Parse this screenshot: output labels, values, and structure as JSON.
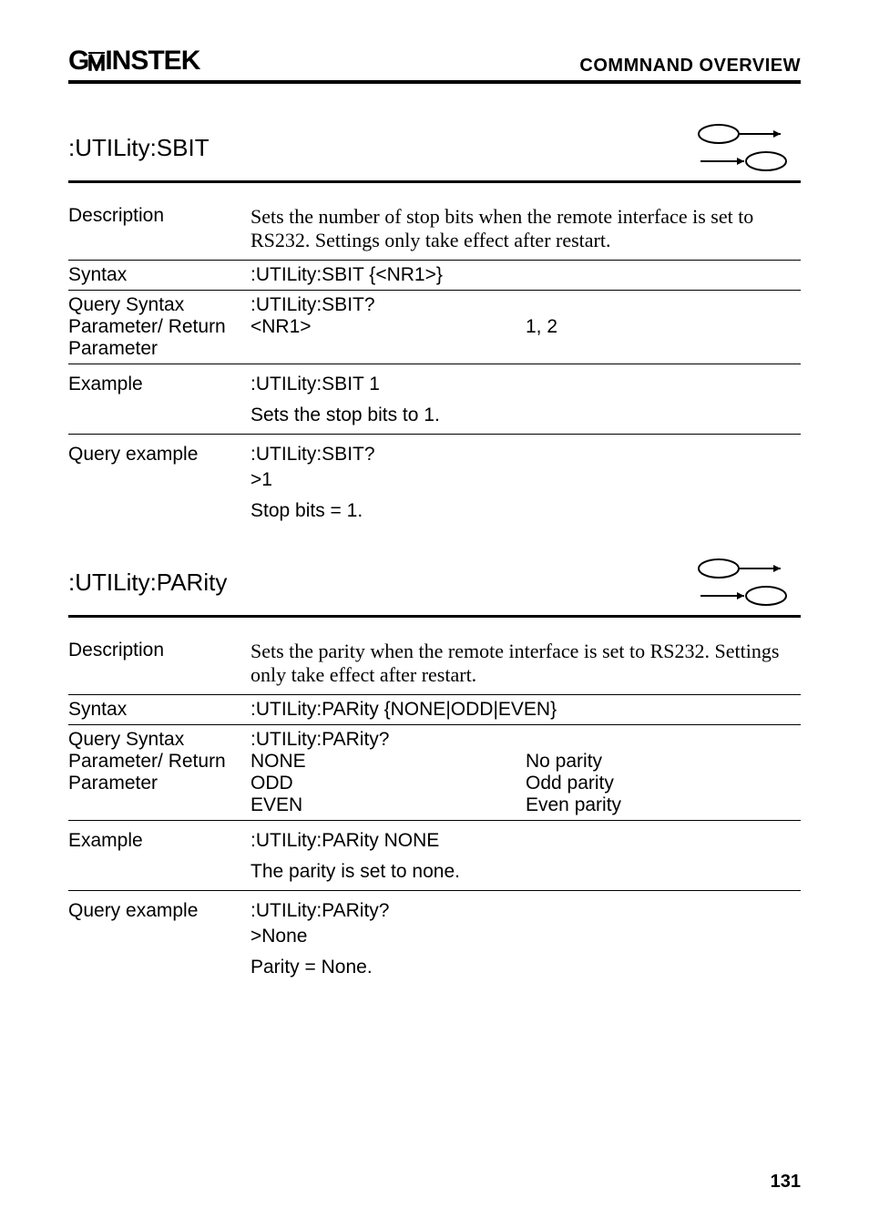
{
  "header": {
    "logo_text": "GWINSTEK",
    "page_header": "COMMNAND OVERVIEW"
  },
  "section1": {
    "title": ":UTILity:SBIT",
    "description_label": "Description",
    "description_text": "Sets the number of stop bits when the remote interface is set to RS232. Settings only take effect after restart.",
    "syntax_label": "Syntax",
    "syntax_value": ":UTILity:SBIT {<NR1>}",
    "query_syntax_label": "Query Syntax",
    "query_syntax_value": ":UTILity:SBIT?",
    "param_label": "Parameter/ Return Parameter",
    "param_key": "<NR1>",
    "param_value": "1, 2",
    "example_label": "Example",
    "example_cmd": ":UTILity:SBIT 1",
    "example_note": "Sets the stop bits to 1.",
    "query_example_label": "Query example",
    "query_example_cmd": ":UTILity:SBIT?",
    "query_example_response": ">1",
    "query_example_note": "Stop bits = 1."
  },
  "section2": {
    "title": ":UTILity:PARity",
    "description_label": "Description",
    "description_text": "Sets the parity when the remote interface is set to RS232. Settings only take effect after restart.",
    "syntax_label": "Syntax",
    "syntax_value": ":UTILity:PARity {NONE|ODD|EVEN}",
    "query_syntax_label": "Query Syntax",
    "query_syntax_value": ":UTILity:PARity?",
    "param_label": "Parameter/ Return Parameter",
    "param_key1": "NONE",
    "param_val1": "No parity",
    "param_key2": "ODD",
    "param_val2": "Odd parity",
    "param_key3": "EVEN",
    "param_val3": "Even parity",
    "example_label": "Example",
    "example_cmd": ":UTILity:PARity NONE",
    "example_note": "The parity is set to none.",
    "query_example_label": "Query example",
    "query_example_cmd": ":UTILity:PARity?",
    "query_example_response": ">None",
    "query_example_note": "Parity = None."
  },
  "page_number": "131"
}
